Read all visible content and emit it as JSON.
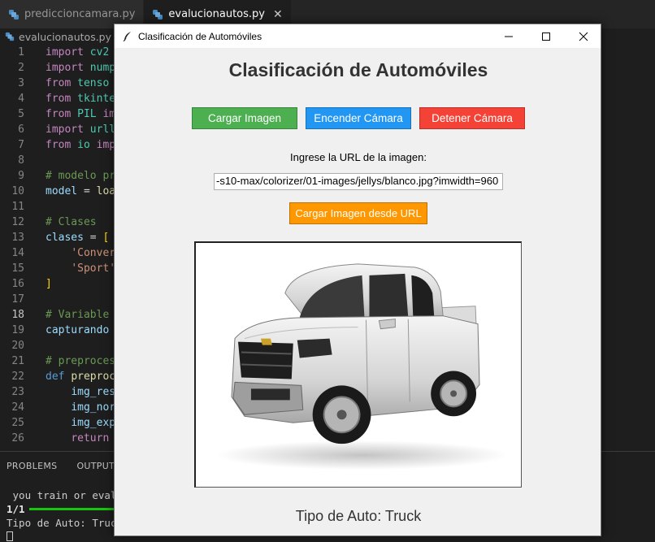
{
  "editor": {
    "tabs": [
      {
        "label": "prediccioncamara.py",
        "active": false
      },
      {
        "label": "evalucionautos.py",
        "active": true
      }
    ],
    "breadcrumb": "evalucionautos.py",
    "current_line": 18
  },
  "code_lines": [
    {
      "num": "1",
      "parts": [
        [
          "kw",
          "import"
        ],
        [
          "id",
          " cv2"
        ]
      ]
    },
    {
      "num": "2",
      "parts": [
        [
          "kw",
          "import"
        ],
        [
          "id",
          " nump"
        ]
      ]
    },
    {
      "num": "3",
      "parts": [
        [
          "kw",
          "from"
        ],
        [
          "id",
          " tenso"
        ]
      ]
    },
    {
      "num": "4",
      "parts": [
        [
          "kw",
          "from"
        ],
        [
          "id",
          " tkinte"
        ]
      ]
    },
    {
      "num": "5",
      "parts": [
        [
          "kw",
          "from"
        ],
        [
          "id",
          " PIL "
        ],
        [
          "kw",
          "im"
        ]
      ]
    },
    {
      "num": "6",
      "parts": [
        [
          "kw",
          "import"
        ],
        [
          "id",
          " urll"
        ]
      ]
    },
    {
      "num": "7",
      "parts": [
        [
          "kw",
          "from"
        ],
        [
          "id",
          " io "
        ],
        [
          "kw",
          "imp"
        ]
      ]
    },
    {
      "num": "8",
      "parts": []
    },
    {
      "num": "9",
      "parts": [
        [
          "cm",
          "# modelo pr"
        ]
      ]
    },
    {
      "num": "10",
      "parts": [
        [
          "var",
          "model"
        ],
        [
          "txt",
          " = "
        ],
        [
          "fn",
          "loa"
        ]
      ]
    },
    {
      "num": "11",
      "parts": []
    },
    {
      "num": "12",
      "parts": [
        [
          "cm",
          "# Clases"
        ]
      ]
    },
    {
      "num": "13",
      "parts": [
        [
          "var",
          "clases"
        ],
        [
          "txt",
          " = "
        ],
        [
          "br",
          "["
        ]
      ]
    },
    {
      "num": "14",
      "parts": [
        [
          "txt",
          "    "
        ],
        [
          "str",
          "'Conver"
        ]
      ]
    },
    {
      "num": "15",
      "parts": [
        [
          "txt",
          "    "
        ],
        [
          "str",
          "'Sport'"
        ]
      ]
    },
    {
      "num": "16",
      "parts": [
        [
          "br",
          "]"
        ]
      ]
    },
    {
      "num": "17",
      "parts": []
    },
    {
      "num": "18",
      "parts": [
        [
          "cm",
          "# Variable "
        ]
      ]
    },
    {
      "num": "19",
      "parts": [
        [
          "var",
          "capturando"
        ]
      ]
    },
    {
      "num": "20",
      "parts": []
    },
    {
      "num": "21",
      "parts": [
        [
          "cm",
          "# preproces"
        ]
      ]
    },
    {
      "num": "22",
      "parts": [
        [
          "kw2",
          "def"
        ],
        [
          "txt",
          " "
        ],
        [
          "fn",
          "preproc"
        ]
      ]
    },
    {
      "num": "23",
      "parts": [
        [
          "txt",
          "    "
        ],
        [
          "var",
          "img_res"
        ]
      ]
    },
    {
      "num": "24",
      "parts": [
        [
          "txt",
          "    "
        ],
        [
          "var",
          "img_nor"
        ]
      ]
    },
    {
      "num": "25",
      "parts": [
        [
          "txt",
          "    "
        ],
        [
          "var",
          "img_exp"
        ]
      ]
    },
    {
      "num": "26",
      "parts": [
        [
          "txt",
          "    "
        ],
        [
          "kw",
          "return"
        ]
      ]
    }
  ],
  "panel": {
    "tabs": [
      "PROBLEMS",
      "OUTPUT"
    ],
    "lines": [
      " you train or evalu",
      "1/1",
      "Tipo de Auto: Truck"
    ]
  },
  "app": {
    "window_title": "Clasificación de Automóviles",
    "heading": "Clasificación de Automóviles",
    "buttons": {
      "load_image": "Cargar Imagen",
      "start_camera": "Encender Cámara",
      "stop_camera": "Detener Cámara",
      "load_url": "Cargar Imagen desde URL"
    },
    "url_label": "Ingrese la URL de la imagen:",
    "url_value": "-s10-max/colorizer/01-images/jellys/blanco.jpg?imwidth=960",
    "result": "Tipo de Auto: Truck",
    "image": "white pickup truck"
  },
  "colors": {
    "green": "#4caf50",
    "blue": "#2196f3",
    "red": "#f44336",
    "orange": "#ff9800"
  }
}
